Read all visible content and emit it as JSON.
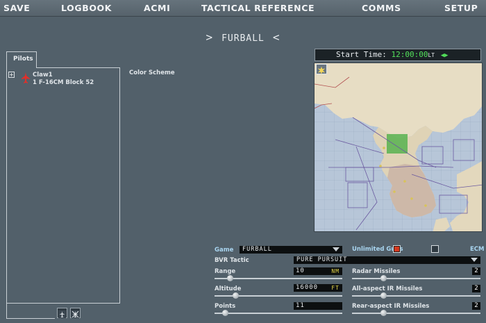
{
  "menu": [
    "SAVE",
    "LOGBOOK",
    "ACMI",
    "TACTICAL REFERENCE",
    "COMMS",
    "SETUP"
  ],
  "mode": {
    "left_arrow": ">",
    "title": "FURBALL",
    "right_arrow": "<"
  },
  "pilots": {
    "tab_label": "Pilots",
    "expand_symbol": "+",
    "entries": [
      {
        "callsign": "Claw1",
        "aircraft": "1 F-16CM Block 52"
      }
    ]
  },
  "color_scheme_label": "Color Scheme",
  "start_time": {
    "label": "Start Time:",
    "value": "12:00:00",
    "suffix": "LT",
    "arrows": "◀▶"
  },
  "settings": {
    "game_label": "Game",
    "game_value": "Furball",
    "unlimited_guns_label": "Unlimited Guns",
    "unlimited_guns_checked": true,
    "ecm_label": "ECM",
    "ecm_checked": false,
    "bvr_label": "BVR Tactic",
    "bvr_value": "Pure Pursuit",
    "range_label": "Range",
    "range_value": "10",
    "range_unit": "NM",
    "range_level": 0.05,
    "altitude_label": "Altitude",
    "altitude_value": "16000",
    "altitude_unit": "FT",
    "altitude_level": 0.17,
    "points_label": "Points",
    "points_value": "11",
    "points_level": 0.1,
    "radar_label": "Radar Missiles",
    "radar_value": "2",
    "radar_level": 0.2,
    "allaspect_label": "All-aspect IR Missiles",
    "allaspect_value": "2",
    "allaspect_level": 0.2,
    "rearaspect_label": "Rear-aspect IR Missiles",
    "rearaspect_value": "2",
    "rearaspect_level": 0.2
  },
  "colors": {
    "background": "#52606a",
    "accent_label": "#a9d5f0",
    "time_green": "#52e05a",
    "unit_yellow": "#e6d84a",
    "checkbox_on": "#d6391f"
  }
}
